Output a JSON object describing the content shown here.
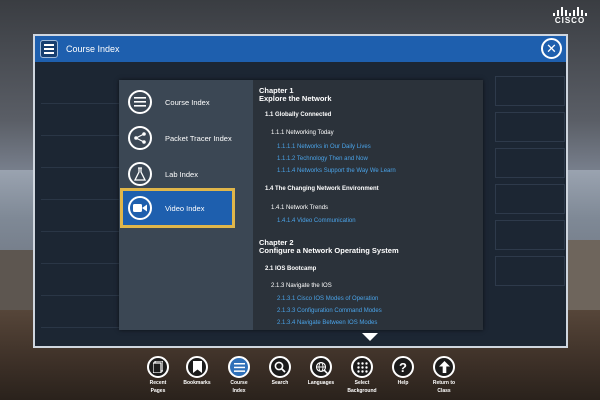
{
  "app": {
    "window_title": "Course Index",
    "brand": "CISCO"
  },
  "colors": {
    "header_blue": "#1e5fae",
    "highlight_border": "#e0b64a",
    "link_blue": "#4aa3e8",
    "panel_bg": "#2b323a",
    "nav_bg": "#3b4754"
  },
  "nav": {
    "items": [
      {
        "label": "Course Index",
        "icon": "list-icon"
      },
      {
        "label": "Packet Tracer Index",
        "icon": "network-icon"
      },
      {
        "label": "Lab Index",
        "icon": "flask-icon"
      },
      {
        "label": "Video Index",
        "icon": "video-camera-icon",
        "active": true
      }
    ]
  },
  "index": {
    "ch1": {
      "title_line1": "Chapter 1",
      "title_line2": "Explore the Network",
      "s1": "1.1 Globally Connected",
      "t1": "1.1.1 Networking Today",
      "l1": "1.1.1.1 Networks in Our Daily Lives",
      "l2": "1.1.1.2 Technology Then and Now",
      "l3": "1.1.1.4 Networks Support the Way We Learn",
      "s2": "1.4 The Changing Network Environment",
      "t2": "1.4.1 Network Trends",
      "l4": "1.4.1.4 Video Communication"
    },
    "ch2": {
      "title_line1": "Chapter 2",
      "title_line2": "Configure a Network Operating System",
      "s1": "2.1 IOS Bootcamp",
      "t1": "2.1.3 Navigate the IOS",
      "l1": "2.1.3.1 Cisco IOS Modes of Operation",
      "l2": "2.1.3.3 Configuration Command Modes",
      "l3": "2.1.3.4 Navigate Between IOS Modes"
    }
  },
  "toolbar": {
    "items": [
      {
        "label1": "Recent",
        "label2": "Pages",
        "icon": "pages-icon"
      },
      {
        "label1": "Bookmarks",
        "label2": "",
        "icon": "bookmark-icon"
      },
      {
        "label1": "Course",
        "label2": "Index",
        "icon": "list-icon",
        "active": true
      },
      {
        "label1": "Search",
        "label2": "",
        "icon": "search-icon"
      },
      {
        "label1": "Languages",
        "label2": "",
        "icon": "globe-icon"
      },
      {
        "label1": "Select",
        "label2": "Background",
        "icon": "grid-dots-icon"
      },
      {
        "label1": "Help",
        "label2": "",
        "icon": "help-icon"
      },
      {
        "label1": "Return to",
        "label2": "Class",
        "icon": "arrow-up-icon"
      }
    ]
  }
}
